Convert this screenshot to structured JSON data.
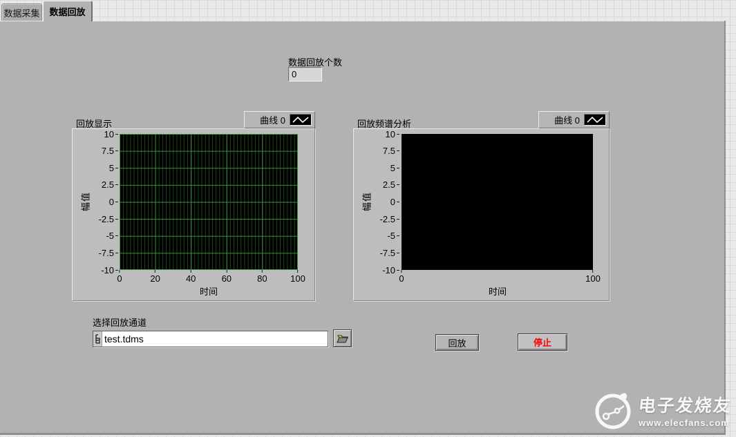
{
  "tabs": {
    "items": [
      {
        "label": "数据采集",
        "active": false
      },
      {
        "label": "数据回放",
        "active": true
      }
    ]
  },
  "counter": {
    "label": "数据回放个数",
    "value": "0"
  },
  "charts": [
    {
      "title": "回放显示",
      "legend_label": "曲线 0",
      "legend_icon": "plot-line-icon",
      "ylabel": "幅值",
      "xlabel": "时间",
      "y_ticks": [
        "10",
        "7.5",
        "5",
        "2.5",
        "0",
        "-2.5",
        "-5",
        "-7.5",
        "-10"
      ],
      "x_ticks": [
        "0",
        "20",
        "40",
        "60",
        "80",
        "100"
      ],
      "y_range": [
        -10,
        10
      ],
      "x_range": [
        0,
        100
      ],
      "grid": true,
      "plot_bg": "#000000",
      "grid_color": "#2e8b2e",
      "series": []
    },
    {
      "title": "回放频谱分析",
      "legend_label": "曲线 0",
      "legend_icon": "plot-line-icon",
      "ylabel": "幅值",
      "xlabel": "时间",
      "y_ticks": [
        "10",
        "7.5",
        "5",
        "2.5",
        "0",
        "-2.5",
        "-5",
        "-7.5",
        "-10"
      ],
      "x_ticks": [
        "0",
        "100"
      ],
      "y_range": [
        -10,
        10
      ],
      "x_range": [
        0,
        100
      ],
      "grid": false,
      "plot_bg": "#000000",
      "series": []
    }
  ],
  "file_control": {
    "label": "选择回放通道",
    "value": "test.tdms",
    "glyph": "path-type-icon",
    "browse": "open-folder-icon"
  },
  "buttons": {
    "play": {
      "label": "回放",
      "text_color": "#000000"
    },
    "stop": {
      "label": "停止",
      "text_color": "#fb0207"
    }
  },
  "watermark": {
    "title": "电子发烧友",
    "url": "www.elecfans.com"
  },
  "colors": {
    "panel_gray": "#b2b2b2",
    "grid_bg": "#e9e9e9",
    "plot_grid_green": "#2e8b2e",
    "stop_red": "#fb0207"
  }
}
